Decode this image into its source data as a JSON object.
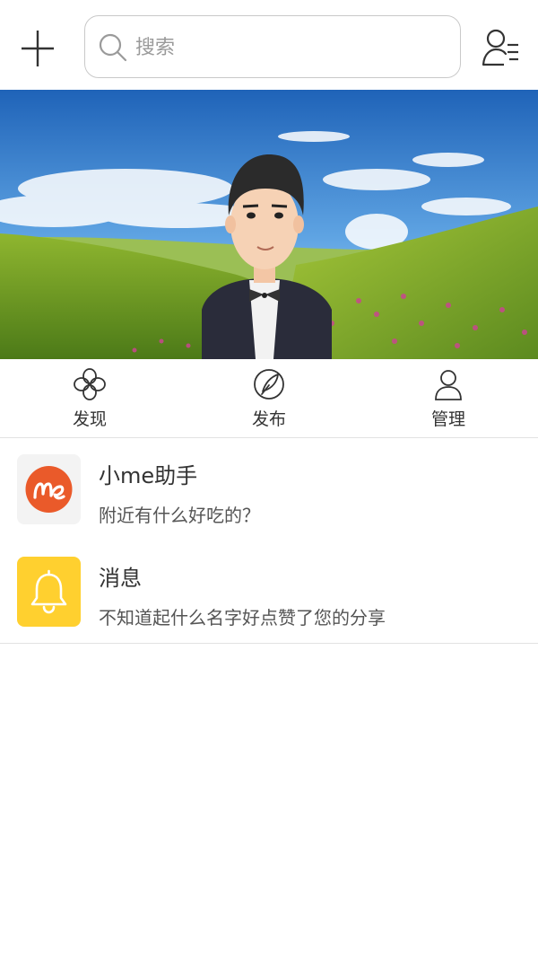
{
  "header": {
    "search_placeholder": "搜索",
    "add_icon": "plus-icon",
    "profile_icon": "user-list-icon"
  },
  "banner": {
    "description_icon": "banner-illustration"
  },
  "nav": {
    "items": [
      {
        "label": "发现",
        "icon": "clover-icon"
      },
      {
        "label": "发布",
        "icon": "feather-icon"
      },
      {
        "label": "管理",
        "icon": "person-icon"
      }
    ]
  },
  "messages": [
    {
      "title": "小me助手",
      "subtitle": "附近有什么好吃的？",
      "avatar": "me-logo",
      "avatar_color": "#ea5a2a"
    },
    {
      "title": "消息",
      "subtitle": "不知道起什么名字好点赞了您的分享",
      "avatar": "bell-icon",
      "avatar_color": "#ffd02f"
    }
  ],
  "colors": {
    "accent_orange": "#ea5a2a",
    "accent_yellow": "#ffd02f",
    "divider": "#e2e2e2"
  }
}
